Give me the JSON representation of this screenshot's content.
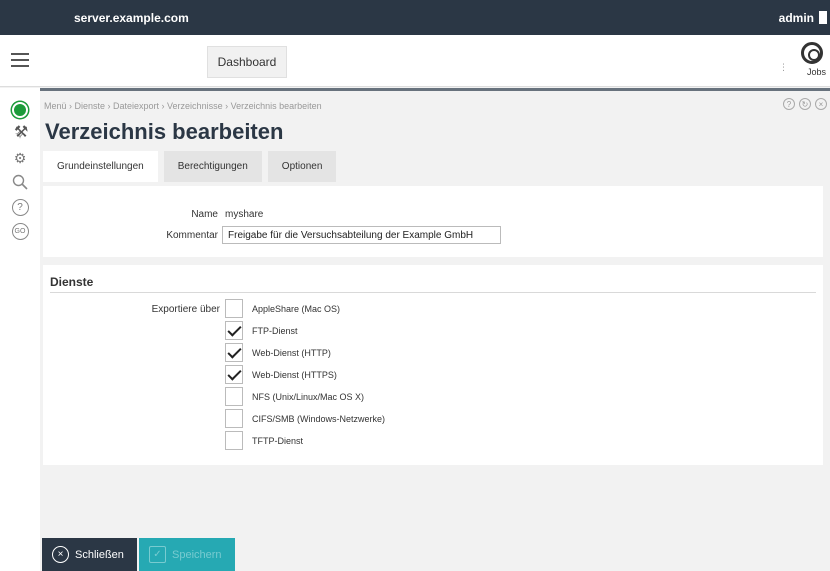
{
  "topbar": {
    "hostname": "server.example.com",
    "user": "admin"
  },
  "header": {
    "dashboard_label": "Dashboard",
    "jobs_label": "Jobs",
    "more_dots": "⋮"
  },
  "breadcrumb": {
    "text": "Menü › Dienste › Dateiexport › Verzeichnisse › Verzeichnis bearbeiten"
  },
  "page": {
    "title": "Verzeichnis bearbeiten"
  },
  "tabs": [
    {
      "label": "Grundeinstellungen",
      "active": true
    },
    {
      "label": "Berechtigungen",
      "active": false
    },
    {
      "label": "Optionen",
      "active": false
    }
  ],
  "form": {
    "name_label": "Name",
    "name_value": "myshare",
    "comment_label": "Kommentar",
    "comment_value": "Freigabe für die Versuchsabteilung der Example GmbH"
  },
  "services": {
    "section_title": "Dienste",
    "export_label": "Exportiere über",
    "options": [
      {
        "label": "AppleShare (Mac OS)",
        "checked": false
      },
      {
        "label": "FTP-Dienst",
        "checked": true
      },
      {
        "label": "Web-Dienst (HTTP)",
        "checked": true
      },
      {
        "label": "Web-Dienst (HTTPS)",
        "checked": true
      },
      {
        "label": "NFS (Unix/Linux/Mac OS X)",
        "checked": false
      },
      {
        "label": "CIFS/SMB (Windows-Netzwerke)",
        "checked": false
      },
      {
        "label": "TFTP-Dienst",
        "checked": false
      }
    ]
  },
  "buttons": {
    "close_label": "Schließen",
    "save_label": "Speichern"
  },
  "colors": {
    "topbar": "#2b3745",
    "status_ok": "#1c9b3a",
    "save": "#26a9b3"
  }
}
